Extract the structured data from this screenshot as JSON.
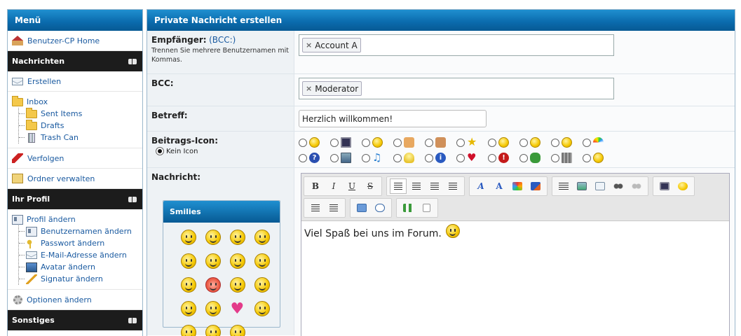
{
  "sidebar": {
    "title": "Menü",
    "home": "Benutzer-CP Home",
    "sections": {
      "messages": "Nachrichten",
      "profile": "Ihr Profil",
      "misc": "Sonstiges"
    },
    "create": "Erstellen",
    "inbox": "Inbox",
    "folders": [
      "Sent Items",
      "Drafts",
      "Trash Can"
    ],
    "track": "Verfolgen",
    "manage_folders": "Ordner verwalten",
    "profile_edit": "Profil ändern",
    "profile_items": [
      "Benutzernamen ändern",
      "Passwort ändern",
      "E-Mail-Adresse ändern",
      "Avatar ändern",
      "Signatur ändern"
    ],
    "options": "Optionen ändern"
  },
  "form": {
    "title": "Private Nachricht erstellen",
    "recipient_label": "Empfänger:",
    "bcc_link": "(BCC:)",
    "recipient_hint": "Trennen Sie mehrere Benutzernamen mit Kommas.",
    "recipient_tag": "Account A",
    "bcc_label": "BCC:",
    "bcc_tag": "Moderator",
    "subject_label": "Betreff:",
    "subject_value": "Herzlich willkommen!",
    "icon_label": "Beitrags-Icon:",
    "no_icon": "Kein Icon",
    "message_label": "Nachricht:",
    "smilies_title": "Smilies",
    "message_text": "Viel Spaß bei uns im Forum.",
    "remove_x": "×"
  },
  "toolbar": {
    "bold": "B",
    "italic": "I",
    "underline": "U",
    "strike": "S",
    "font_a": "A",
    "size_a": "A"
  },
  "post_icons_row1": [
    "smile-icon",
    "film-icon",
    "smile-icon",
    "thumbs-up-icon",
    "thumbs-down-icon",
    "star-icon",
    "smile-icon",
    "smile-icon",
    "smile-icon",
    "rainbow-icon"
  ],
  "post_icons_row2": [
    "question-icon",
    "image-icon",
    "music-note-icon",
    "lightbulb-icon",
    "info-icon",
    "heart-icon",
    "exclamation-icon",
    "bug-icon",
    "castle-icon",
    "grin-icon"
  ],
  "colors": {
    "header_blue": "#0a6aac",
    "section_dark": "#1c1c1c",
    "link": "#1a5aa0"
  }
}
